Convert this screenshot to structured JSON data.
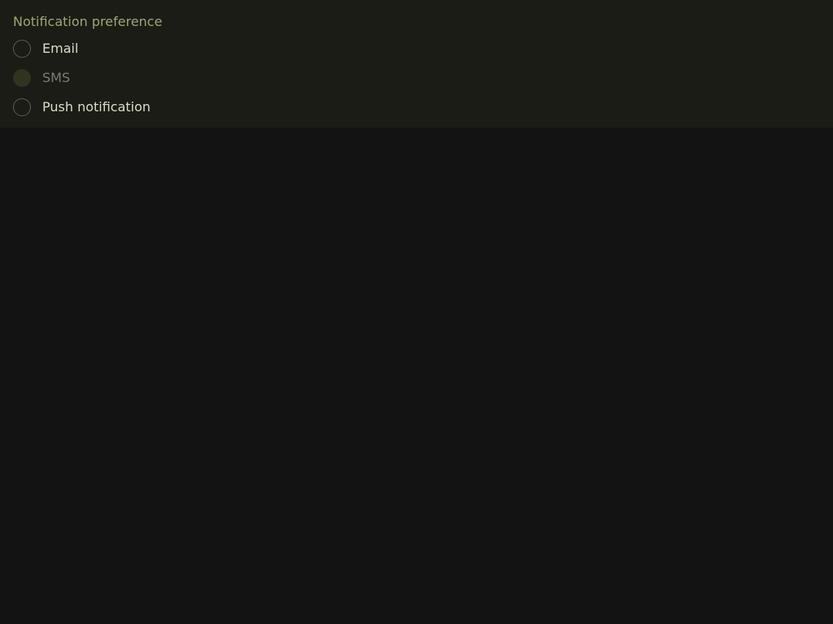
{
  "group": {
    "label": "Notification preference",
    "options": [
      {
        "label": "Email",
        "selected": false,
        "disabled": false
      },
      {
        "label": "SMS",
        "selected": false,
        "disabled": true
      },
      {
        "label": "Push notification",
        "selected": false,
        "disabled": false
      }
    ]
  },
  "colors": {
    "page_background": "#131313",
    "panel_background": "#1b1c16",
    "group_label": "#9aa874",
    "option_text": "#dcdcc8",
    "option_text_disabled": "#7c7d72",
    "radio_border": "#5a5d4c",
    "radio_disabled_fill": "#30331f"
  }
}
